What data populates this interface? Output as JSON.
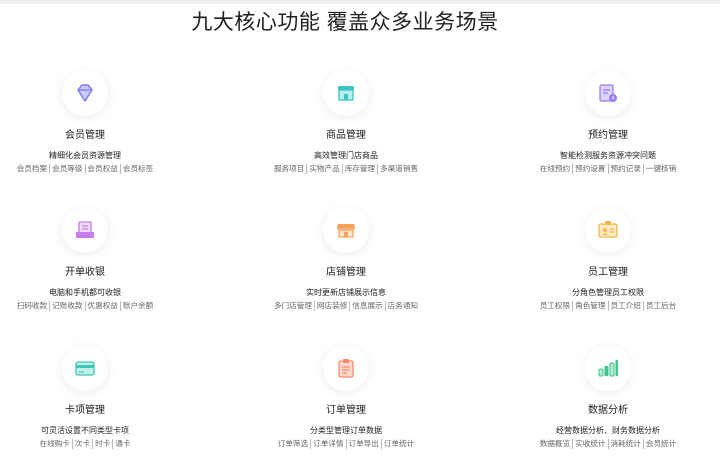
{
  "title": "九大核心功能 覆盖众多业务场景",
  "features": [
    {
      "name": "会员管理",
      "desc": "精细化会员资源管理",
      "tags": [
        "会员档案",
        "会员等级",
        "会员权益",
        "会员标签"
      ],
      "icon": "diamond-icon",
      "color": "#8c8cf2"
    },
    {
      "name": "商品管理",
      "desc": "高效管理门店商品",
      "tags": [
        "服务项目",
        "实物产品",
        "库存管理",
        "多渠道销售"
      ],
      "icon": "shop-icon",
      "color": "#3cc5c5"
    },
    {
      "name": "预约管理",
      "desc": "智能检测服务资源冲突问题",
      "tags": [
        "在线预约",
        "预约设置",
        "预约记录",
        "一键核销"
      ],
      "icon": "calendar-clock-icon",
      "color": "#9b7ff0"
    },
    {
      "name": "开单收银",
      "desc": "电脑和手机都可收银",
      "tags": [
        "扫码收款",
        "记账收款",
        "优惠权益",
        "账户余额"
      ],
      "icon": "receipt-icon",
      "color": "#c77df0"
    },
    {
      "name": "店铺管理",
      "desc": "实时更新店铺展示信息",
      "tags": [
        "多门店管理",
        "网店装修",
        "信息展示",
        "店务通知"
      ],
      "icon": "storefront-icon",
      "color": "#f6a05a"
    },
    {
      "name": "员工管理",
      "desc": "分角色管理员工权限",
      "tags": [
        "员工权限",
        "角色管理",
        "员工介绍",
        "员工后台"
      ],
      "icon": "id-card-icon",
      "color": "#f5b84a"
    },
    {
      "name": "卡项管理",
      "desc": "可灵活设置不同类型卡项",
      "tags": [
        "在线购卡",
        "次卡",
        "时卡",
        "通卡"
      ],
      "icon": "card-icon",
      "color": "#3cc8b4"
    },
    {
      "name": "订单管理",
      "desc": "分类型管理订单数据",
      "tags": [
        "订单筛选",
        "订单详情",
        "订单导出",
        "订单统计"
      ],
      "icon": "clipboard-icon",
      "color": "#f58a6a"
    },
    {
      "name": "数据分析",
      "desc": "经营数据分析、财务数据分析",
      "tags": [
        "数据概览",
        "实收统计",
        "消耗统计",
        "会员统计"
      ],
      "icon": "bar-chart-icon",
      "color": "#3cc48a"
    }
  ]
}
